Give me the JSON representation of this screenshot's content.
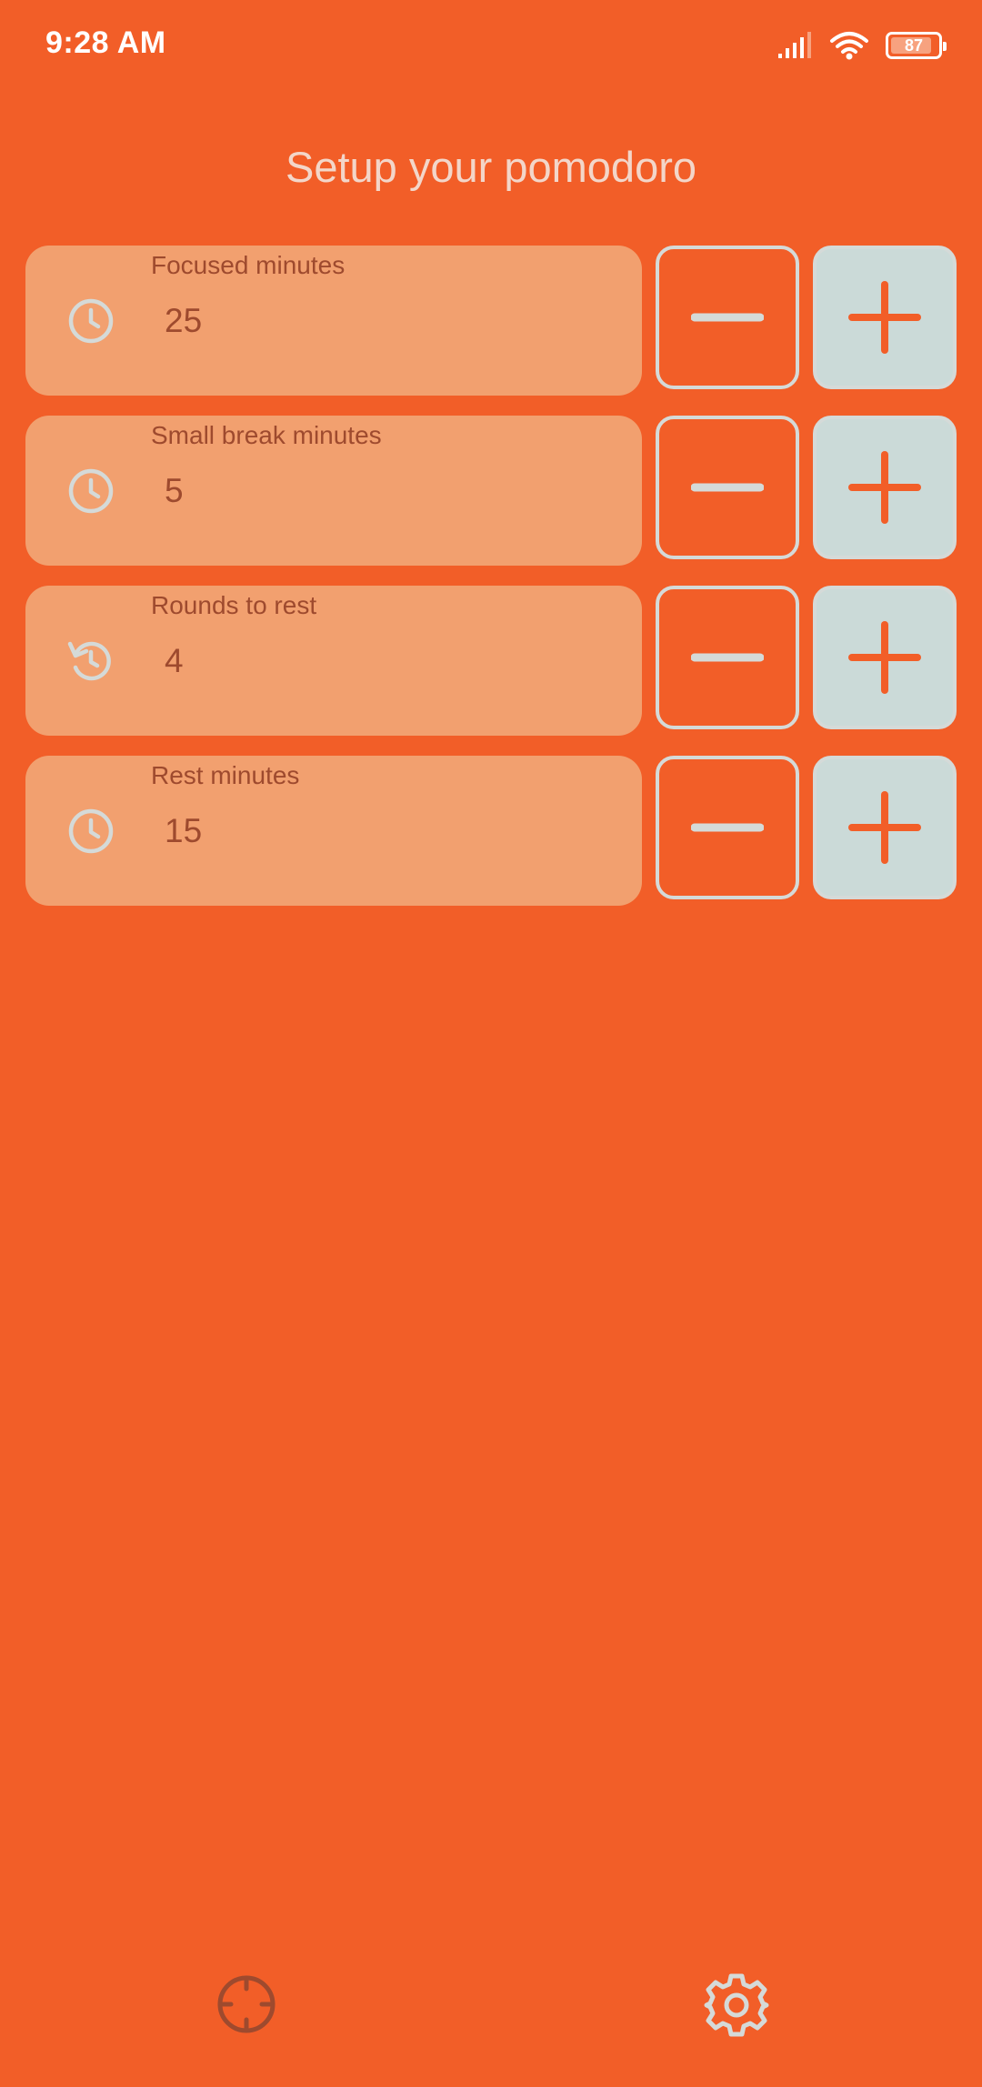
{
  "status_bar": {
    "time": "9:28 AM",
    "battery": "87",
    "icons": [
      "signal-icon",
      "wifi-icon",
      "battery-icon"
    ]
  },
  "title": "Setup your pomodoro",
  "colors": {
    "background": "#F25E28",
    "field": "#F2A06F",
    "field_text": "#9E4A2E",
    "button_border": "#D5DAD8",
    "plus_fill": "#CBDAD8",
    "title": "#F3D6C9"
  },
  "settings": [
    {
      "label": "Focused minutes",
      "value": "25",
      "icon": "clock-icon"
    },
    {
      "label": "Small break minutes",
      "value": "5",
      "icon": "clock-icon"
    },
    {
      "label": "Rounds to rest",
      "value": "4",
      "icon": "restart-icon"
    },
    {
      "label": "Rest minutes",
      "value": "15",
      "icon": "clock-icon"
    }
  ],
  "controls": {
    "decrement_icon": "minus-icon",
    "increment_icon": "plus-icon"
  },
  "bottom_nav": {
    "items": [
      {
        "icon": "crosshair-icon"
      },
      {
        "icon": "gear-icon"
      }
    ]
  }
}
